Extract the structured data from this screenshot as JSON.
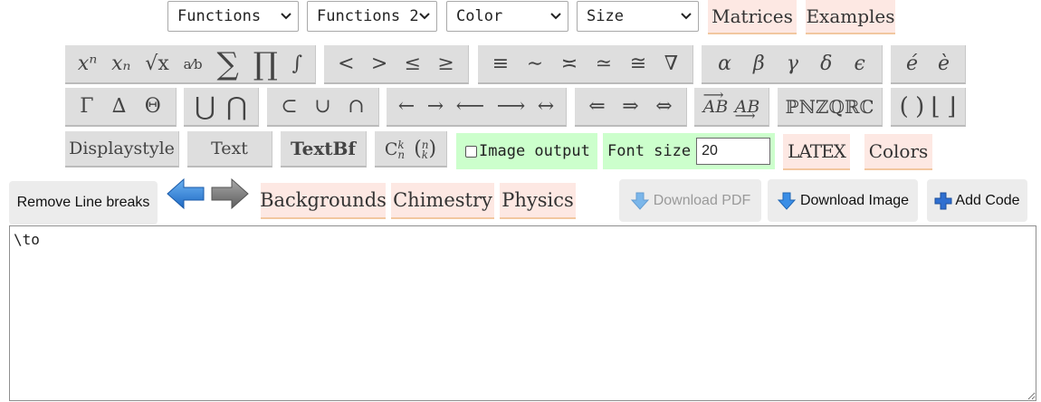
{
  "selects": {
    "functions": "Functions",
    "functions2": "Functions 2",
    "color": "Color",
    "size": "Size"
  },
  "top_buttons": {
    "matrices": "Matrices",
    "examples": "Examples"
  },
  "toolbar_row1": {
    "powers": [
      "xⁿ",
      "xₙ",
      "√x",
      "a⁄b",
      "∑",
      "∏",
      "∫"
    ],
    "relations": [
      "<",
      ">",
      "≤",
      "≥"
    ],
    "equivalences": [
      "≡",
      "∼",
      "≍",
      "≃",
      "≅",
      "∇"
    ],
    "greek": [
      "α",
      "β",
      "γ",
      "δ",
      "ϵ"
    ],
    "accents": [
      "é",
      "è"
    ]
  },
  "toolbar_row2": {
    "greek_upper": [
      "Γ",
      "∆",
      "Θ"
    ],
    "big_sets": [
      "⋃",
      "⋂"
    ],
    "sets": [
      "⊂",
      "∪",
      "∩"
    ],
    "arrows": [
      "←",
      "→",
      "⟵",
      "⟶",
      "↔"
    ],
    "double_arrows": [
      "⇐",
      "⇒",
      "⇔"
    ],
    "vectors": [
      "AB",
      "AB"
    ],
    "number_sets": "ℙℕℤℚℝℂ",
    "brackets": [
      "(",
      ")",
      "⌊",
      "⌋"
    ]
  },
  "toolbar_row3": {
    "displaystyle": "Displaystyle",
    "text": "Text",
    "textbf": "TextBf",
    "binomial": "C",
    "image_output_label": "Image output",
    "image_output_checked": false,
    "font_size_label": "Font size",
    "font_size_value": "20",
    "latex_label": "LATEX",
    "colors": "Colors"
  },
  "toolbar_row4": {
    "remove_line_breaks": "Remove Line breaks",
    "backgrounds": "Backgrounds",
    "chemistry": "Chimestry",
    "physics": "Physics",
    "download_pdf": "Download PDF",
    "download_image": "Download Image",
    "add_code": "Add Code"
  },
  "editor": {
    "content": "\\to"
  },
  "colors": {
    "pink_button": "#fde8e3",
    "grey_button": "#dedede",
    "green_box": "#ccffcc",
    "undo_arrow": "#2f7fd4",
    "redo_arrow": "#707070",
    "download_icon": "#3a8ee6",
    "add_icon": "#2f6fd0"
  }
}
